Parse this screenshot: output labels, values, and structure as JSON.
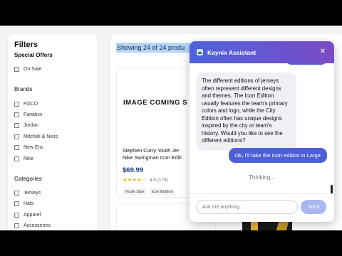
{
  "filters": {
    "title": "Filters",
    "special_offers": {
      "heading": "Special Offers",
      "options": [
        "On Sale"
      ]
    },
    "brands": {
      "heading": "Brands",
      "options": [
        "FOCO",
        "Fanatics",
        "Jordan",
        "Mitchell & Ness",
        "New Era",
        "Nike"
      ]
    },
    "categories": {
      "heading": "Categories",
      "options": [
        "Jerseys",
        "Hats",
        "Apparel",
        "Accessories"
      ]
    }
  },
  "results": {
    "showing": "Showing 24 of 24 produ"
  },
  "product": {
    "image_text": "IMAGE COMING S",
    "title_line1": "Stephen Curry Youth Jer",
    "title_line2": "Nike Swingman Icon Editi",
    "price": "$69.99",
    "stars": "★★★★☆",
    "rating": "4.9",
    "reviews": "(178)",
    "tags": [
      "Youth Size",
      "Icon Edition"
    ]
  },
  "chat": {
    "title": "Kaynix Assistant",
    "close_icon": "close-icon",
    "bot_message": "The different editions of jerseys often represent different designs and themes. The Icon Edition usually features the team's primary colors and logo, while the City Edition often has unique designs inspired by the city or team's history. Would you like to see the different editions?",
    "user_message": "Ok, I'll take the Icon edition in Large",
    "status": "Thinking...",
    "input_placeholder": "Ask me anything...",
    "send_label": "Send"
  },
  "colors": {
    "accent": "#4f5fd8",
    "header_gradient_start": "#4e63dd",
    "header_gradient_end": "#7b4bc6",
    "price": "#1e3a8a",
    "star": "#f5b50a"
  }
}
